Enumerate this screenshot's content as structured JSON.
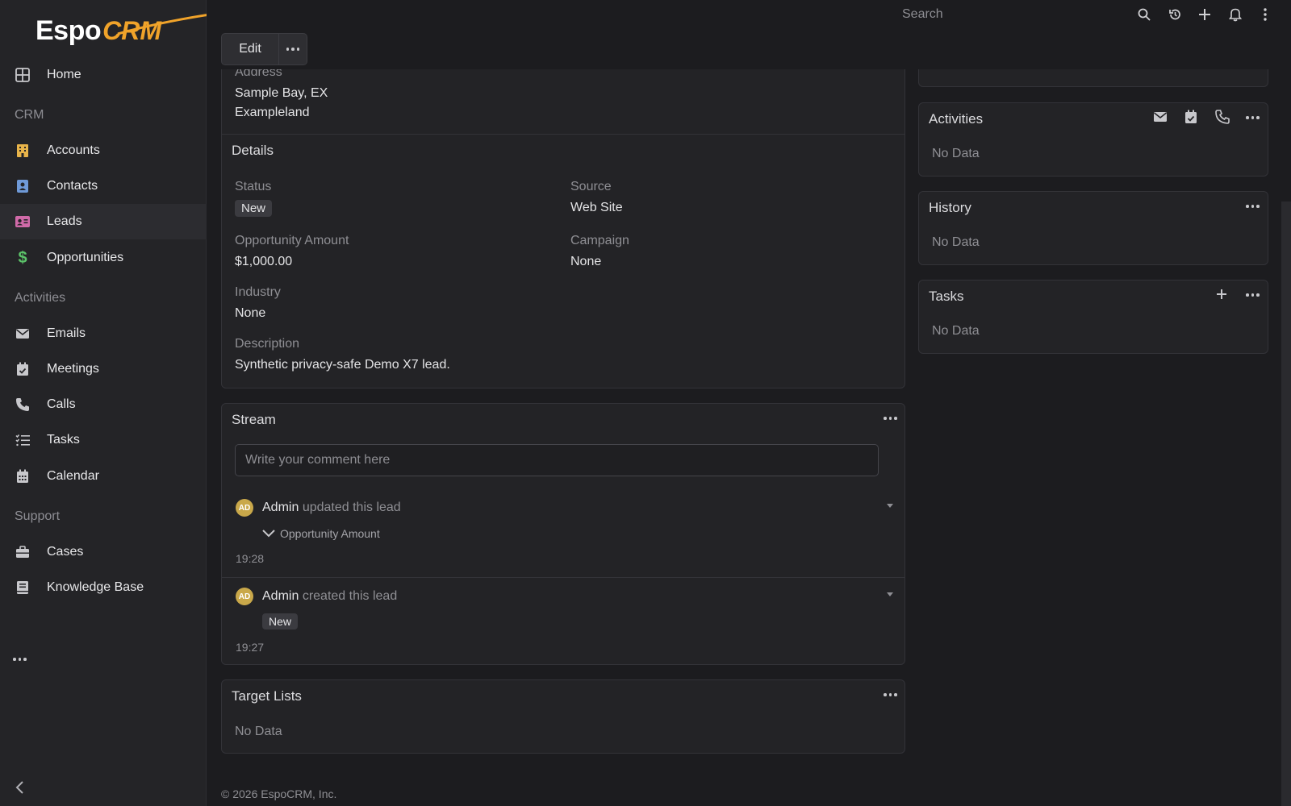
{
  "app": {
    "logo_primary": "Espo",
    "logo_secondary": "CRM"
  },
  "sidebar": {
    "items": [
      {
        "label": "Home",
        "icon": "home-grid-icon"
      },
      {
        "label": "Accounts",
        "icon": "building-icon"
      },
      {
        "label": "Contacts",
        "icon": "contact-book-icon"
      },
      {
        "label": "Leads",
        "icon": "id-card-icon"
      },
      {
        "label": "Opportunities",
        "icon": "dollar-icon"
      },
      {
        "label": "Emails",
        "icon": "envelope-icon"
      },
      {
        "label": "Meetings",
        "icon": "calendar-check-icon"
      },
      {
        "label": "Calls",
        "icon": "phone-icon"
      },
      {
        "label": "Tasks",
        "icon": "task-list-icon"
      },
      {
        "label": "Calendar",
        "icon": "calendar-grid-icon"
      },
      {
        "label": "Cases",
        "icon": "briefcase-icon"
      },
      {
        "label": "Knowledge Base",
        "icon": "book-icon"
      }
    ],
    "groups": {
      "crm": "CRM",
      "activities": "Activities",
      "support": "Support"
    },
    "active": "Leads"
  },
  "topbar": {
    "search_placeholder": "Search"
  },
  "toolbar": {
    "edit_label": "Edit"
  },
  "overview": {
    "address_label": "Address",
    "address_line1": "Sample Bay, EX",
    "address_line2": "Exampleland"
  },
  "details": {
    "title": "Details",
    "status_label": "Status",
    "status_value": "New",
    "source_label": "Source",
    "source_value": "Web Site",
    "amount_label": "Opportunity Amount",
    "amount_value": "$1,000.00",
    "campaign_label": "Campaign",
    "campaign_value": "None",
    "industry_label": "Industry",
    "industry_value": "None",
    "description_label": "Description",
    "description_value": "Synthetic privacy-safe Demo X7 lead."
  },
  "stream": {
    "title": "Stream",
    "comment_placeholder": "Write your comment here",
    "notes": [
      {
        "user": "Admin",
        "action": "updated this lead",
        "field": "Opportunity Amount",
        "time": "19:28",
        "initials": "AD"
      },
      {
        "user": "Admin",
        "action": "created this lead",
        "badge": "New",
        "time": "19:27",
        "initials": "AD"
      }
    ]
  },
  "target_lists": {
    "title": "Target Lists",
    "empty": "No Data"
  },
  "side_panels": {
    "activities": {
      "title": "Activities",
      "empty": "No Data"
    },
    "history": {
      "title": "History",
      "empty": "No Data"
    },
    "tasks": {
      "title": "Tasks",
      "empty": "No Data"
    }
  },
  "footer": {
    "copyright": "© 2026 EspoCRM, Inc."
  },
  "colors": {
    "background": "#1c1c1f",
    "panel": "#232326",
    "sidebar": "#242427",
    "logo_accent": "#f0a32a",
    "avatar": "#c9a84a"
  }
}
